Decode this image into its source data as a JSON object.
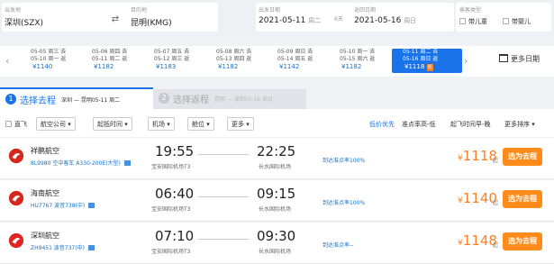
{
  "search": {
    "from_label": "出发地",
    "from_value": "深圳(SZX)",
    "to_label": "目的地",
    "to_value": "昆明(KMG)",
    "depart_label": "出发日期",
    "depart_date": "2021-05-11",
    "depart_day": "周二",
    "nights": "6天",
    "return_label": "返回日期",
    "return_date": "2021-05-16",
    "return_day": "周日",
    "passenger_label": "乘客类型",
    "child": "带儿童",
    "infant": "带婴儿"
  },
  "date_bar": {
    "prev_arrow": "‹",
    "next_arrow": "›",
    "items": [
      {
        "l1": "05-05 周三 去",
        "l2": "05-10 周一 返",
        "price": "¥1140"
      },
      {
        "l1": "05-06 周四 去",
        "l2": "05-11 周二 返",
        "price": "¥1182"
      },
      {
        "l1": "05-07 周五 去",
        "l2": "05-12 周三 返",
        "price": "¥1183"
      },
      {
        "l1": "05-08 周六 去",
        "l2": "05-13 周四 返",
        "price": "¥1182"
      },
      {
        "l1": "05-09 周日 去",
        "l2": "05-14 周五 返",
        "price": "¥1142"
      },
      {
        "l1": "05-10 周一 去",
        "l2": "05-15 周六 返",
        "price": "¥1182"
      },
      {
        "l1": "05-11 周二 去",
        "l2": "05-16 周日 返",
        "price": "¥1118",
        "badge": "低"
      }
    ],
    "calendar": "更多日期"
  },
  "tabs": {
    "t1_num": "1",
    "t1_title": "选择去程",
    "t1_sub": "深圳 — 昆明05-11 周二",
    "t2_num": "2",
    "t2_title": "选择返程",
    "t2_sub": "昆明 — 深圳05-16 周日"
  },
  "filters": {
    "direct": "直飞",
    "airline": "航空公司 ▾",
    "dep_time": "起抵时间 ▾",
    "airport": "机场 ▾",
    "cabin": "舱位 ▾",
    "more": "更多 ▾",
    "low_first": "低价优先",
    "ontime_high": "准点率高-低",
    "dep_early": "起飞时间早-晚",
    "more_sort": "更多排序 ▾"
  },
  "flights": [
    {
      "airline": "祥鹏航空",
      "info": "8L9980 空中客车 A330-200E(大型)",
      "dep": "19:55",
      "dep_apt": "宝安国际机场T3",
      "arr": "22:25",
      "arr_apt": "长水国际机场",
      "ontime": "到达准点率100%",
      "price": "1118",
      "unit": "起",
      "buy": "选为去程",
      "color": "#d7261b"
    },
    {
      "airline": "海南航空",
      "info": "HU7767 波音738(中)",
      "dep": "06:40",
      "dep_apt": "宝安国际机场T3",
      "arr": "09:15",
      "arr_apt": "长水国际机场",
      "ontime": "到达准点率100%",
      "price": "1140",
      "unit": "起",
      "buy": "选为去程",
      "color": "#d7261b"
    },
    {
      "airline": "深圳航空",
      "info": "ZH9451 波音737(中)",
      "dep": "07:10",
      "dep_apt": "宝安国际机场T3",
      "arr": "09:30",
      "arr_apt": "长水国际机场",
      "ontime": "到达准点率--",
      "price": "1148",
      "unit": "起",
      "buy": "选为去程",
      "color": "#e02323"
    }
  ],
  "price_symbol": "¥",
  "colors": {
    "accent": "#1a73e8",
    "price": "#ff7f24",
    "buy": "#ff8c1a"
  }
}
